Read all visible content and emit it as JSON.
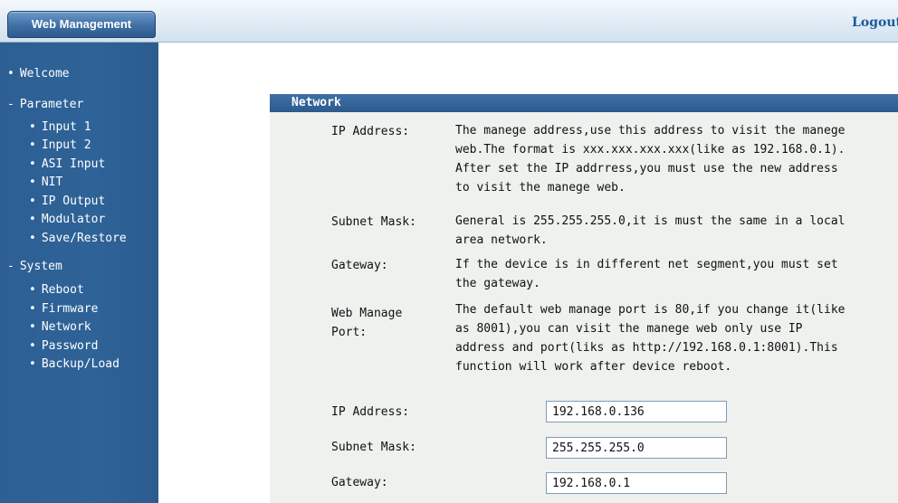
{
  "header": {
    "brand": "Web Management",
    "logout": "Logout"
  },
  "sidebar": {
    "welcome": "Welcome",
    "parameter": {
      "label": "Parameter",
      "items": [
        "Input 1",
        "Input 2",
        "ASI Input",
        "NIT",
        "IP Output",
        "Modulator",
        "Save/Restore"
      ]
    },
    "system": {
      "label": "System",
      "items": [
        "Reboot",
        "Firmware",
        "Network",
        "Password",
        "Backup/Load"
      ]
    }
  },
  "network": {
    "title": "Network",
    "help": [
      {
        "label": "IP Address:",
        "text": "The manege address,use this address to visit the manege\nweb.The format is xxx.xxx.xxx.xxx(like as 192.168.0.1).\nAfter set the IP addrress,you must use the new address\nto visit the manege web."
      },
      {
        "label": "Subnet Mask:",
        "text": "General is 255.255.255.0,it is must the same in a local\narea network."
      },
      {
        "label": "Gateway:",
        "text": "If the device is in different net segment,you must set\nthe gateway."
      },
      {
        "label": "Web Manage\nPort:",
        "text": "The default web manage port is 80,if you change it(like\nas 8001),you can visit the manege web only use IP\naddress and port(liks as http://192.168.0.1:8001).This\nfunction will work after device reboot."
      }
    ],
    "fields": {
      "ip_label": "IP Address:",
      "ip_value": "192.168.0.136",
      "mask_label": "Subnet Mask:",
      "mask_value": "255.255.255.0",
      "gw_label": "Gateway:",
      "gw_value": "192.168.0.1"
    }
  }
}
